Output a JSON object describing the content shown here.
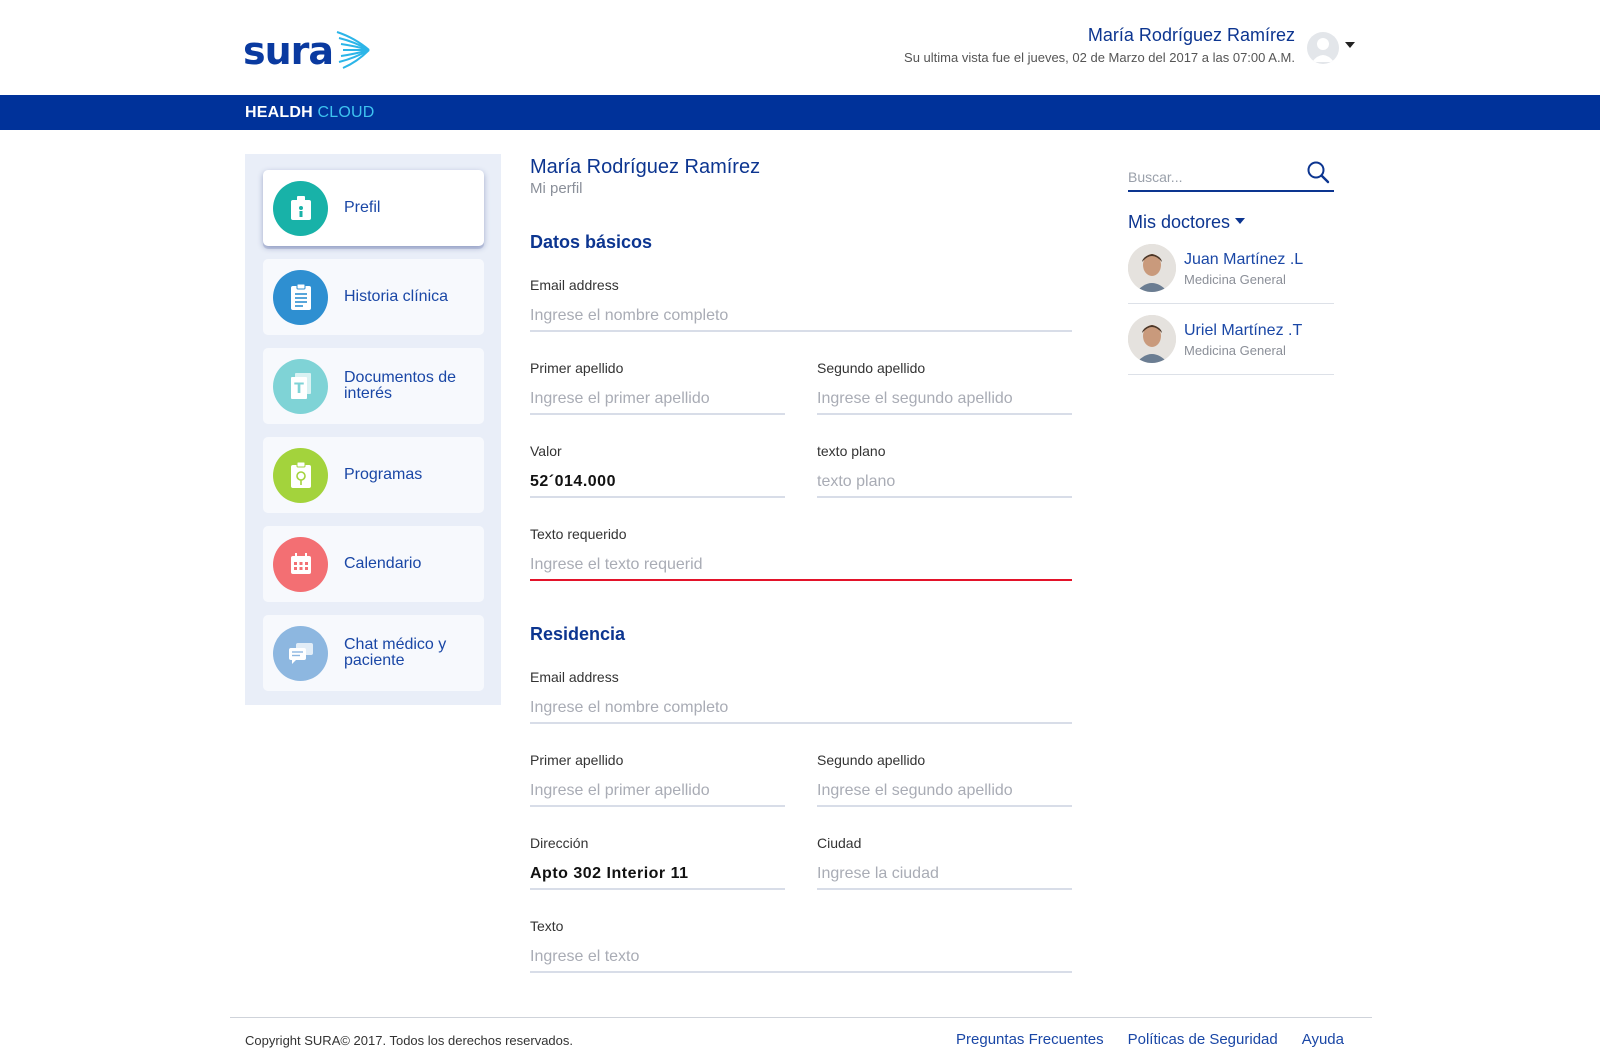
{
  "header": {
    "logo_text": "sura",
    "user_name": "María Rodríguez Ramírez",
    "last_visit": "Su ultima vista fue el jueves, 02 de Marzo del 2017 a las 07:00 A.M."
  },
  "brand": {
    "primary": "HEALDH",
    "accent": "CLOUD"
  },
  "colors": {
    "brand_blue": "#00329a",
    "accent_cyan": "#3ec3f0",
    "error_red": "#e3132a"
  },
  "sidebar": {
    "items": [
      {
        "label": "Prefil",
        "icon": "profile-icon",
        "color": "#18b2a8",
        "active": true
      },
      {
        "label": "Historia clínica",
        "icon": "clipboard-icon",
        "color": "#2e8fd1",
        "active": false
      },
      {
        "label": "Documentos de interés",
        "icon": "documents-icon",
        "color": "#7fd3d6",
        "active": false
      },
      {
        "label": "Programas",
        "icon": "program-icon",
        "color": "#a3d33c",
        "active": false
      },
      {
        "label": "Calendario",
        "icon": "calendar-icon",
        "color": "#f36f73",
        "active": false
      },
      {
        "label": "Chat médico y paciente",
        "icon": "chat-icon",
        "color": "#8db7e0",
        "active": false
      }
    ]
  },
  "main": {
    "title": "María Rodríguez Ramírez",
    "subtitle": "Mi perfil",
    "basic": {
      "title": "Datos básicos",
      "email_label": "Email address",
      "email_placeholder": "Ingrese el nombre completo",
      "last1_label": "Primer apellido",
      "last1_placeholder": "Ingrese el primer apellido",
      "last2_label": "Segundo apellido",
      "last2_placeholder": "Ingrese el segundo apellido",
      "valor_label": "Valor",
      "valor_value": "52´014.000",
      "plain_label": "texto plano",
      "plain_placeholder": "texto plano",
      "required_label": "Texto requerido",
      "required_placeholder": "Ingrese el texto requerid"
    },
    "residence": {
      "title": "Residencia",
      "email_label": "Email address",
      "email_placeholder": "Ingrese el nombre completo",
      "last1_label": "Primer apellido",
      "last1_placeholder": "Ingrese el primer apellido",
      "last2_label": "Segundo apellido",
      "last2_placeholder": "Ingrese el segundo apellido",
      "address_label": "Dirección",
      "address_value": "Apto 302 Interior 11",
      "city_label": "Ciudad",
      "city_placeholder": "Ingrese la ciudad",
      "text_label": "Texto",
      "text_placeholder": "Ingrese el texto"
    }
  },
  "right": {
    "search_placeholder": "Buscar...",
    "doctors_title": "Mis doctores",
    "doctors": [
      {
        "name": "Juan Martínez .L",
        "specialty": "Medicina General"
      },
      {
        "name": "Uriel Martínez .T",
        "specialty": "Medicina General"
      }
    ]
  },
  "footer": {
    "copyright": "Copyright SURA© 2017. Todos los derechos reservados.",
    "links": [
      "Preguntas Frecuentes",
      "Políticas de Seguridad",
      "Ayuda"
    ]
  }
}
